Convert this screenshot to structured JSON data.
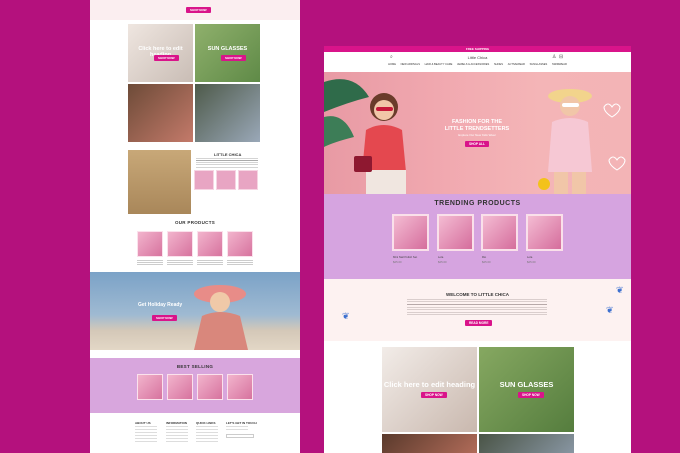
{
  "left_page": {
    "top_button": "SHOP NOW",
    "tiles": [
      {
        "caption": "Click here to edit heading",
        "button": "SHOP NOW"
      },
      {
        "caption": "SUN GLASSES",
        "button": "SHOP NOW"
      },
      {
        "caption": "",
        "button": ""
      },
      {
        "caption": "",
        "button": ""
      }
    ],
    "about_title": "LITTLE CHICA",
    "our_products_title": "OUR PRODUCTS",
    "holiday_title": "Get Holiday Ready",
    "holiday_button": "SHOP NOW",
    "best_selling_title": "BEST SELLING",
    "footer_cols": [
      "ABOUT US",
      "INFORMATION",
      "QUICK LINKS",
      "LET'S GET IN TOUCH"
    ]
  },
  "right_page": {
    "announcement": "FREE SHIPPING",
    "logo": "Little Chica",
    "nav": [
      "HOME",
      "NEW ARRIVALS",
      "HAIR & BEAUTY CARE",
      "JEWELS & ACCESSORIES",
      "SHOES",
      "ACTIVEWEAR",
      "SUNGLASSES",
      "SWIMWEAR"
    ],
    "hero": {
      "title": "FASHION FOR THE LITTLE TRENDSETTERS",
      "subtitle": "Explore Our New Kids Wear",
      "button": "SHOP ALL"
    },
    "trending_title": "TRENDING PRODUCTS",
    "products": [
      {
        "name": "Mini Nail Polish Set",
        "price": "$25.00"
      },
      {
        "name": "Lola",
        "price": "$25.00"
      },
      {
        "name": "Rio",
        "price": "$25.00"
      },
      {
        "name": "Lola",
        "price": "$25.00"
      }
    ],
    "welcome_title": "WELCOME TO LITTLE CHICA",
    "welcome_button": "READ MORE",
    "tiles": [
      {
        "caption": "Click here to edit heading",
        "button": "SHOP NOW"
      },
      {
        "caption": "SUN GLASSES",
        "button": "SHOP NOW"
      }
    ]
  },
  "colors": {
    "background": "#b4117d",
    "accent": "#d9148a",
    "lavender": "#d6a4e0",
    "hero_pink": "#f1a9b0"
  }
}
